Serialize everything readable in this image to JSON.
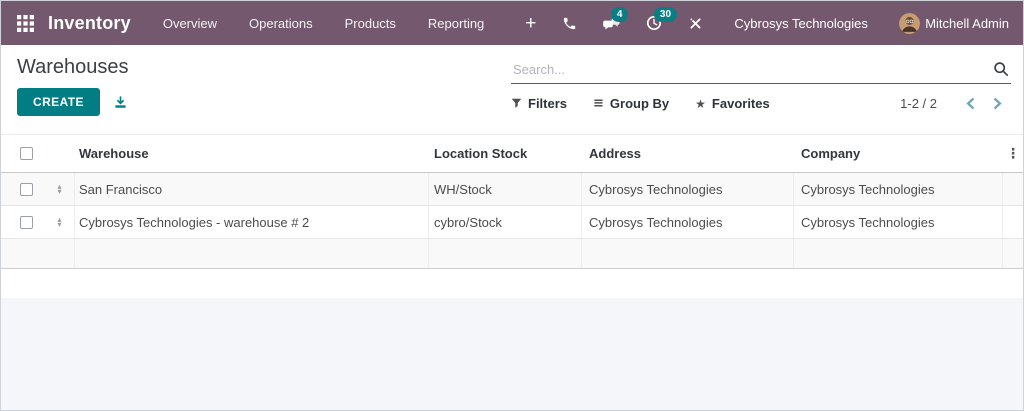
{
  "topbar": {
    "app_name": "Inventory",
    "menus": [
      "Overview",
      "Operations",
      "Products",
      "Reporting"
    ],
    "systray": {
      "messages_badge": "4",
      "activities_badge": "30"
    },
    "company_name": "Cybrosys Technologies",
    "user_name": "Mitchell Admin"
  },
  "control_panel": {
    "title": "Warehouses",
    "create_label": "CREATE",
    "search_placeholder": "Search...",
    "filters_label": "Filters",
    "group_by_label": "Group By",
    "favorites_label": "Favorites",
    "pager_text": "1-2 / 2"
  },
  "table": {
    "columns": [
      "Warehouse",
      "Location Stock",
      "Address",
      "Company"
    ],
    "rows": [
      {
        "warehouse": "San Francisco",
        "location_stock": "WH/Stock",
        "address": "Cybrosys Technologies",
        "company": "Cybrosys Technologies"
      },
      {
        "warehouse": "Cybrosys Technologies - warehouse # 2",
        "location_stock": "cybro/Stock",
        "address": "Cybrosys Technologies",
        "company": "Cybrosys Technologies"
      }
    ]
  },
  "colors": {
    "topbar": "#74586e",
    "accent_teal": "#017e84",
    "badge": "#0b7e85",
    "pager_chevron": "#6fa6b7",
    "footer_bg": "#f5f6fa"
  }
}
